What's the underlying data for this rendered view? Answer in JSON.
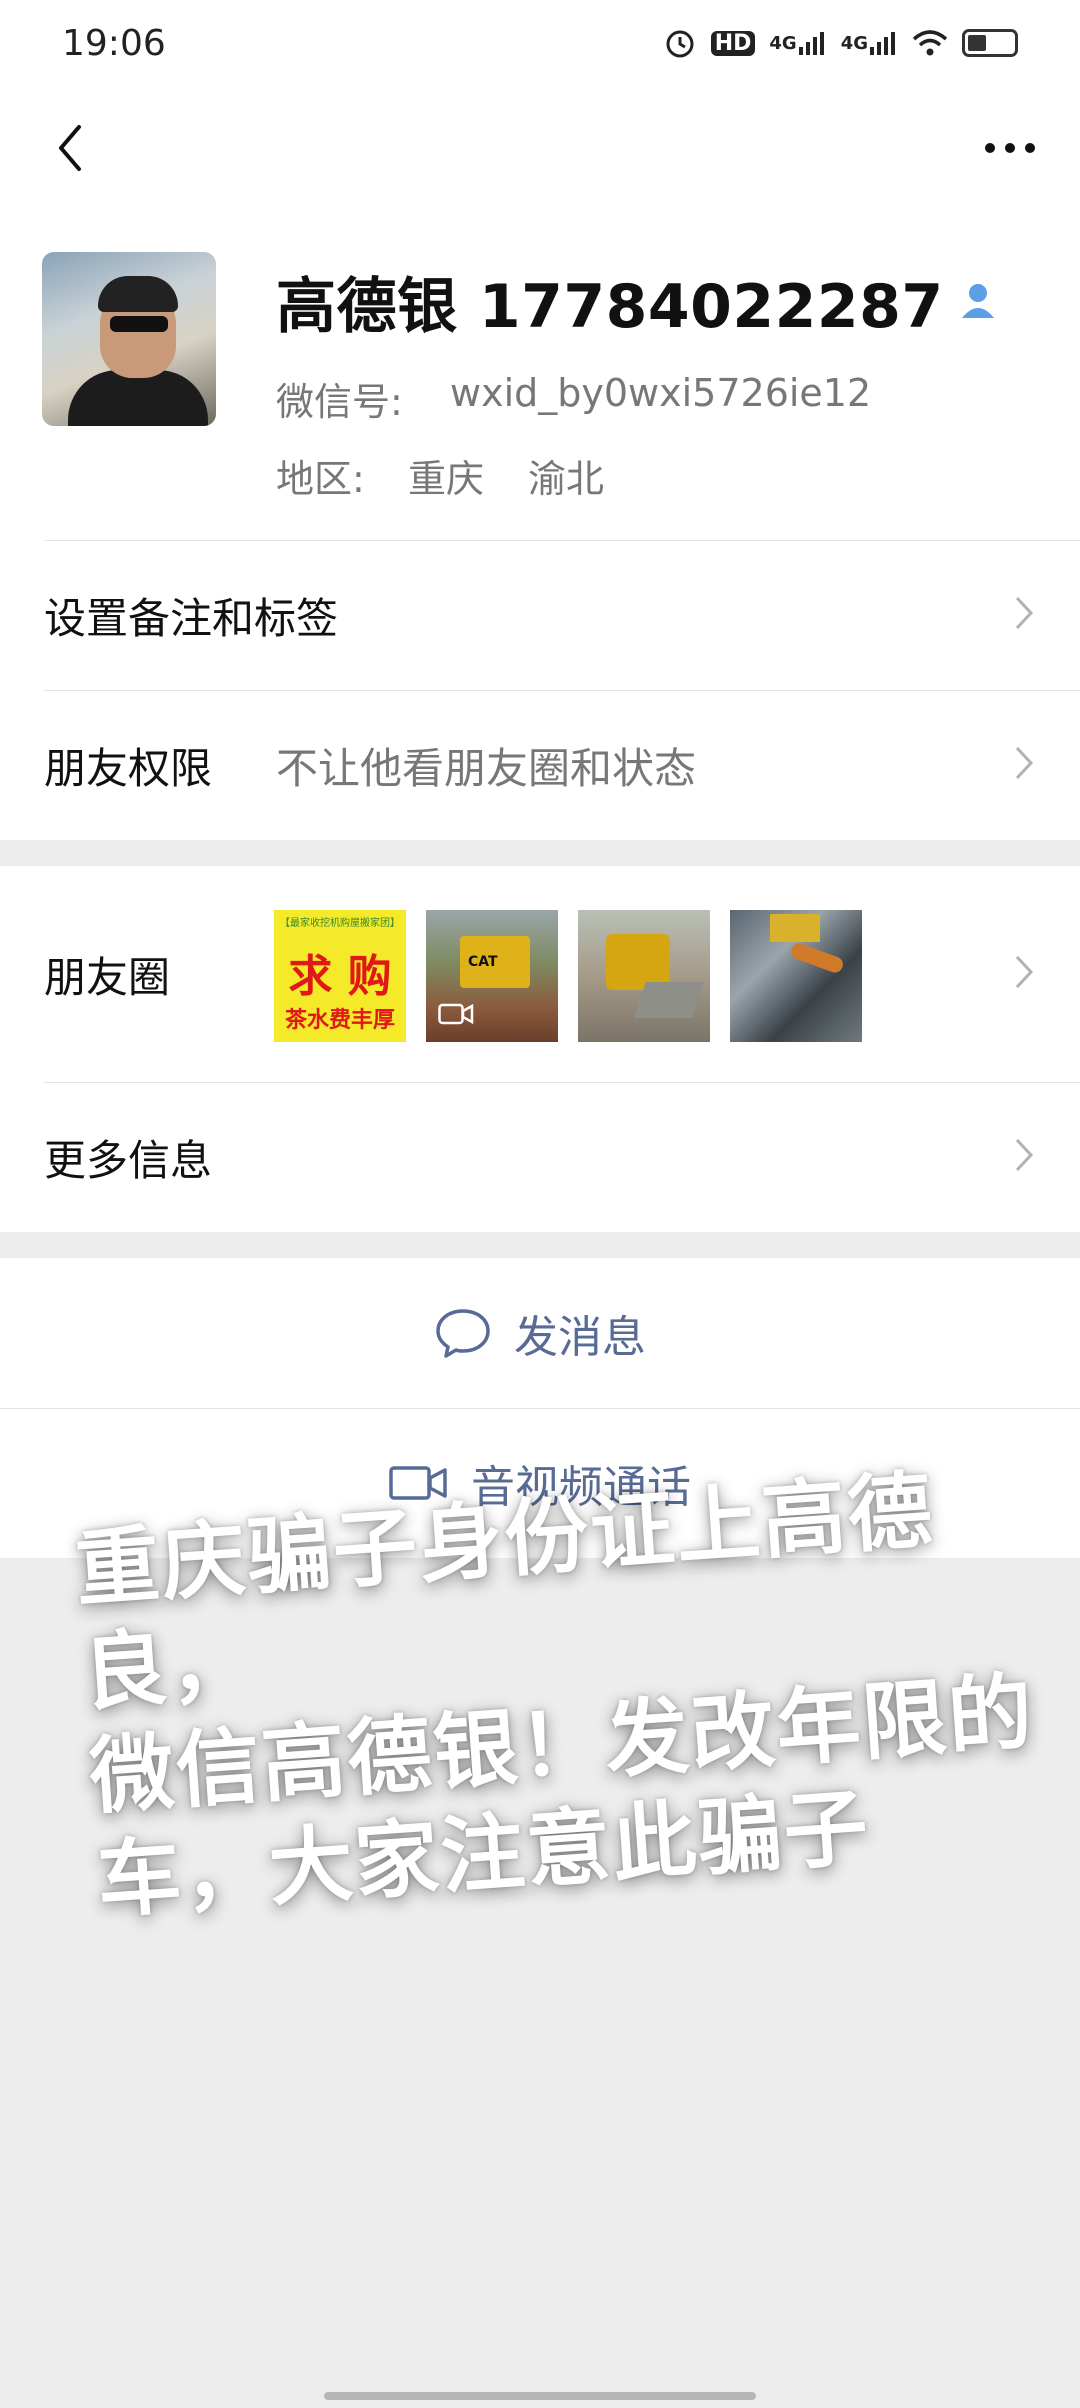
{
  "status_bar": {
    "time": "19:06",
    "icons": [
      "alarm-icon",
      "hd-icon",
      "signal-4g-icon",
      "signal-4g-icon",
      "wifi-icon",
      "battery-icon"
    ],
    "net1": "4G",
    "net2": "4G",
    "hd": "HD"
  },
  "nav": {
    "back_icon": "chevron-left-icon",
    "more_icon": "more-dots-icon"
  },
  "profile": {
    "name": "高德银 17784022287",
    "wechat_id_label": "微信号:",
    "wechat_id": "wxid_by0wxi5726ie12",
    "region_label": "地区:",
    "region_city": "重庆",
    "region_district": "渝北"
  },
  "rows": {
    "remark_label": "设置备注和标签",
    "permissions_label": "朋友权限",
    "permissions_value": "不让他看朋友圈和状态",
    "moments_label": "朋友圈",
    "more_info_label": "更多信息"
  },
  "moments_thumbs": {
    "t1_top": "【最家收挖机购屋搬家团】",
    "t1_mid": "求 购",
    "t1_bot": "茶水费丰厚",
    "t2_brand": "CAT"
  },
  "actions": {
    "message_label": "发消息",
    "call_label": "音视频通话"
  },
  "overlay": {
    "line1": "重庆骗子身份证上高德良，",
    "line2": "微信高德银！发改年限的",
    "line3": "车，大家注意此骗子"
  },
  "colors": {
    "link": "#576b95",
    "background": "#ededed",
    "surface": "#ffffff"
  }
}
